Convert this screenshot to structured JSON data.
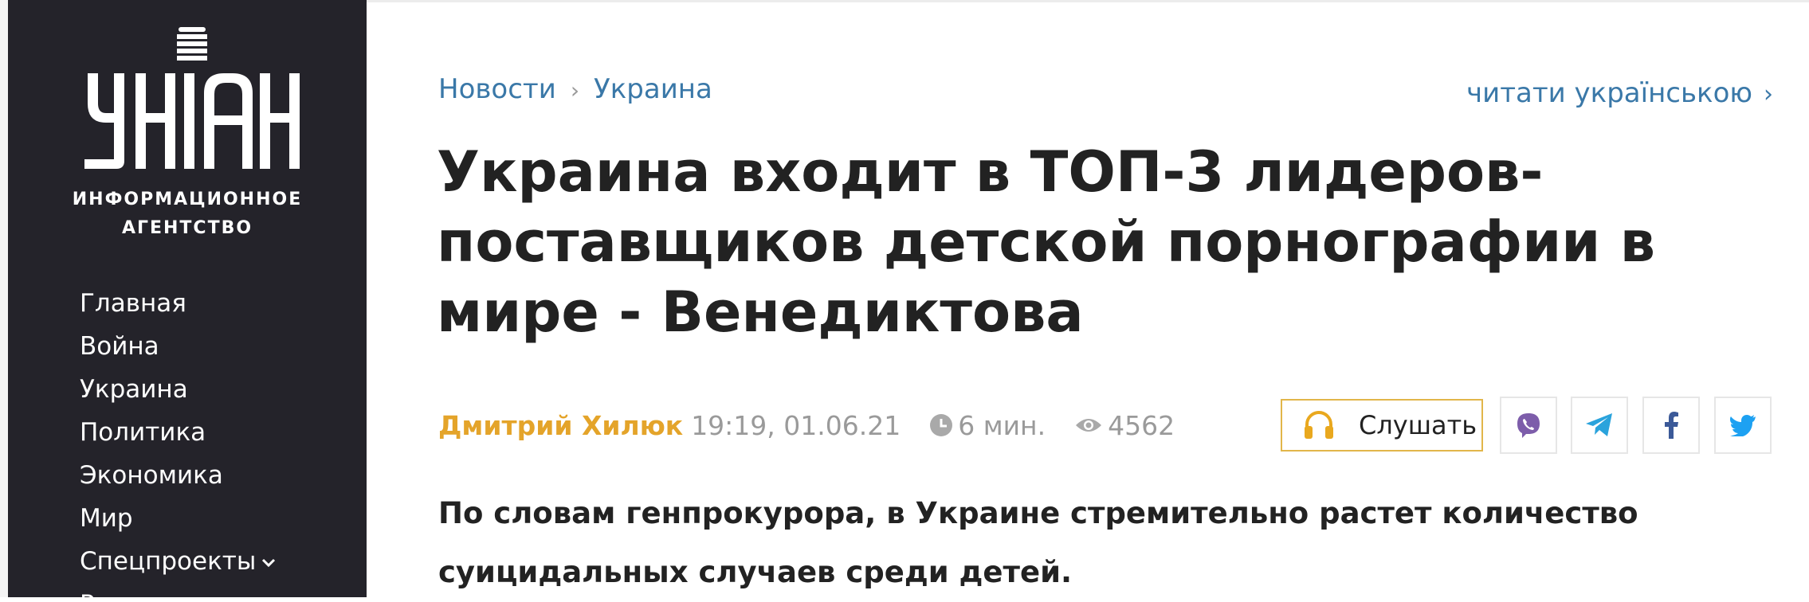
{
  "sidebar": {
    "logo_text": "УНІАН",
    "logo_subtitle_line1": "ИНФОРМАЦИОННОЕ",
    "logo_subtitle_line2": "АГЕНТСТВО",
    "nav": [
      {
        "label": "Главная"
      },
      {
        "label": "Война"
      },
      {
        "label": "Украина"
      },
      {
        "label": "Политика"
      },
      {
        "label": "Экономика"
      },
      {
        "label": "Мир"
      },
      {
        "label": "Спецпроекты",
        "icon": "chevron-down-icon"
      },
      {
        "label": "Разное"
      }
    ]
  },
  "breadcrumb": {
    "items": [
      "Новости",
      "Украина"
    ],
    "separator": "›"
  },
  "language_link": {
    "label": "читати українською",
    "icon": "chevron-right-icon"
  },
  "article": {
    "title": "Украина входит в ТОП-3 лидеров-поставщиков детской порнографии в мире - Венедиктова",
    "author": "Дмитрий Хилюк",
    "datetime": "19:19, 01.06.21",
    "read_time": "6 мин.",
    "views": "4562",
    "lead": "По словам генпрокурора, в Украине стремительно растет количество суицидальных случаев среди детей."
  },
  "listen_button": {
    "label": "Слушать",
    "icon": "headphones-icon"
  },
  "share_buttons": [
    {
      "name": "viber",
      "icon": "viber-icon"
    },
    {
      "name": "telegram",
      "icon": "telegram-icon"
    },
    {
      "name": "facebook",
      "icon": "facebook-icon"
    },
    {
      "name": "twitter",
      "icon": "twitter-icon"
    }
  ],
  "colors": {
    "sidebar_bg": "#24232a",
    "link_blue": "#3a78a8",
    "author_orange": "#e4a42a",
    "muted_gray": "#9a9a9a",
    "viber_purple": "#7d5daa",
    "telegram_blue": "#2aa3dc",
    "facebook_blue": "#3b5998",
    "twitter_blue": "#1da1f2"
  }
}
